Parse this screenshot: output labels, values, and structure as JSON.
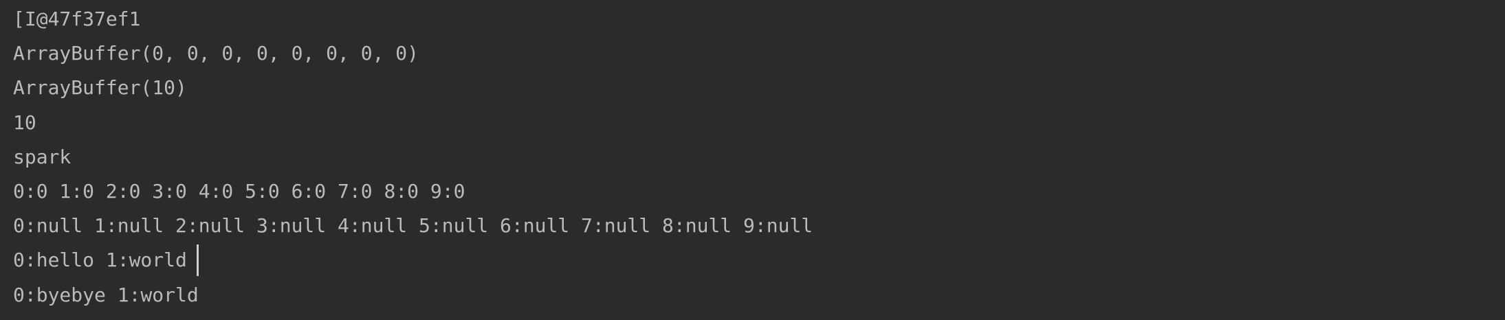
{
  "console": {
    "lines": [
      "[I@47f37ef1",
      "ArrayBuffer(0, 0, 0, 0, 0, 0, 0, 0)",
      "ArrayBuffer(10)",
      "10",
      "spark",
      "0:0 1:0 2:0 3:0 4:0 5:0 6:0 7:0 8:0 9:0",
      "0:null 1:null 2:null 3:null 4:null 5:null 6:null 7:null 8:null 9:null",
      "0:hello 1:world",
      "0:byebye 1:world"
    ]
  }
}
